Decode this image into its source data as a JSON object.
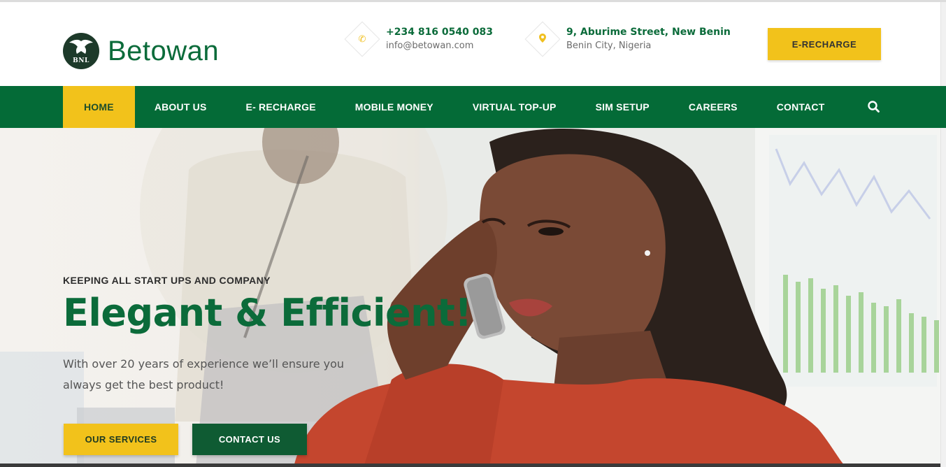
{
  "brand": {
    "name": "Betowan",
    "logo_abbr": "BNL"
  },
  "contact": {
    "phone": "+234 816 0540 083",
    "email": "info@betowan.com",
    "address_line1": "9, Aburime Street, New Benin",
    "address_line2": "Benin City, Nigeria",
    "phone_icon": "phone-icon",
    "location_icon": "map-pin-icon"
  },
  "header": {
    "recharge_button": "E-RECHARGE"
  },
  "nav": {
    "items": [
      {
        "label": "HOME",
        "active": true
      },
      {
        "label": "ABOUT US"
      },
      {
        "label": "E- RECHARGE"
      },
      {
        "label": "MOBILE MONEY"
      },
      {
        "label": "VIRTUAL TOP-UP"
      },
      {
        "label": "SIM SETUP"
      },
      {
        "label": "CAREERS"
      },
      {
        "label": "CONTACT"
      }
    ],
    "search_icon": "search-icon"
  },
  "hero": {
    "subtitle": "KEEPING ALL START UPS AND COMPANY",
    "title": "Elegant & Efficient!",
    "description": "With over 20 years of experience we’ll ensure you always get the best product!",
    "services_button": "OUR SERVICES",
    "contact_button": "CONTACT US"
  },
  "colors": {
    "brand_green": "#046b37",
    "accent_yellow": "#f2c21b",
    "text_dark": "#2d2d2d"
  }
}
